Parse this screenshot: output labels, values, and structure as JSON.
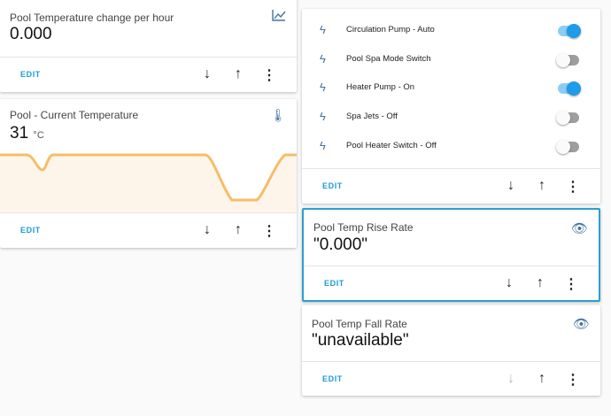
{
  "left": [
    {
      "title": "Pool Temperature change per hour",
      "state": "0.000",
      "icon": "chart-line-icon",
      "edit": "EDIT"
    },
    {
      "title": "Pool - Current Temperature",
      "state": "31",
      "unit": "°C",
      "icon": "thermometer-icon",
      "edit": "EDIT"
    }
  ],
  "switches": {
    "items": [
      {
        "label": "Circulation Pump - Auto",
        "on": true
      },
      {
        "label": "Pool Spa Mode Switch",
        "on": false
      },
      {
        "label": "Heater Pump - On",
        "on": true
      },
      {
        "label": "Spa Jets - Off",
        "on": false
      },
      {
        "label": "Pool Heater Switch - Off",
        "on": false
      }
    ],
    "edit": "EDIT"
  },
  "right": [
    {
      "title": "Pool Temp Rise Rate",
      "state": "\"0.000\"",
      "icon": "eye-icon",
      "edit": "EDIT"
    },
    {
      "title": "Pool Temp Fall Rate",
      "state": "\"unavailable\"",
      "icon": "eye-icon",
      "edit": "EDIT"
    }
  ],
  "colors": {
    "accent": "#1e9ad6",
    "graph": "#f5bd6a",
    "icon": "#44739e"
  }
}
